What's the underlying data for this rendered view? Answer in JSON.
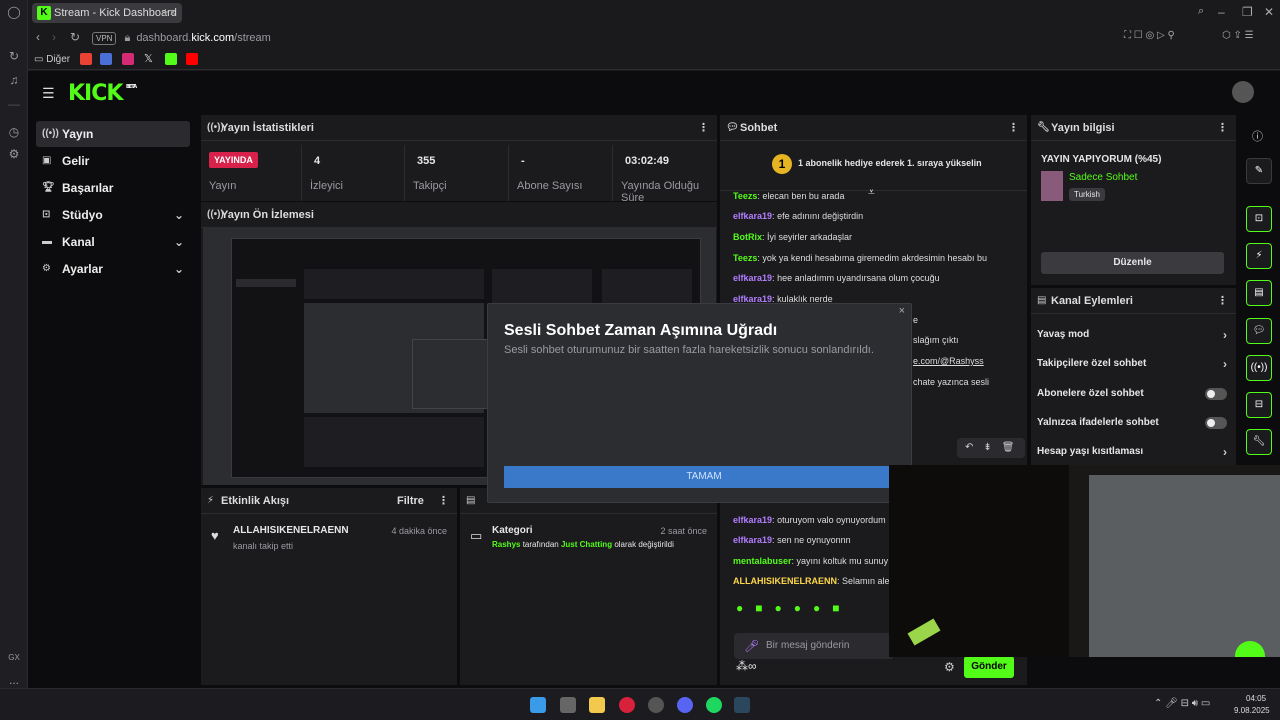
{
  "browser": {
    "tab_title": "Stream - Kick Dashboard",
    "url_domain": "dashboard.",
    "url_bold": "kick.com",
    "url_path": "/stream",
    "vpn": "VPN",
    "bookmark_folder": "Diğer",
    "gx": "GX",
    "more": "..."
  },
  "brand": {
    "logo": "KICK",
    "beta": "BETA",
    "accent": "#53fc18",
    "live_color": "#d8214b",
    "button_color": "#3a79c9"
  },
  "nav": [
    {
      "label": "Yayın",
      "icon": "live-icon",
      "active": true
    },
    {
      "label": "Gelir",
      "icon": "revenue-icon"
    },
    {
      "label": "Başarılar",
      "icon": "trophy-icon"
    },
    {
      "label": "Stüdyo",
      "icon": "studio-icon",
      "expand": true
    },
    {
      "label": "Kanal",
      "icon": "channel-icon",
      "expand": true
    },
    {
      "label": "Ayarlar",
      "icon": "settings-icon",
      "expand": true
    }
  ],
  "stats_panel": {
    "title": "Yayın İstatistikleri",
    "live_badge": "YAYINDA",
    "items": [
      {
        "value": "",
        "label": "Yayın"
      },
      {
        "value": "4",
        "label": "İzleyici"
      },
      {
        "value": "355",
        "label": "Takipçi"
      },
      {
        "value": "-",
        "label": "Abone Sayısı"
      },
      {
        "value": "03:02:49",
        "label": "Yayında Olduğu Süre"
      }
    ]
  },
  "preview_panel": {
    "title": "Yayın Ön İzlemesi"
  },
  "activity_panel": {
    "title": "Etkinlik Akışı",
    "filter": "Filtre",
    "event_user": "ALLAHISIKENELRAENN",
    "event_text": "kanalı takip etti",
    "event_time": "4 dakika önce"
  },
  "edit_panel": {
    "category_title": "Kategori",
    "category_time": "2 saat önce",
    "cat_user": "Rashys",
    "cat_mid": "tarafından",
    "cat_name": "Just Chatting",
    "cat_end": "olarak değiştirildi"
  },
  "chat_panel": {
    "title": "Sohbet",
    "banner_num": "1",
    "banner": "1 abonelik hediye ederek 1. sıraya yükselin",
    "placeholder": "Bir mesaj gönderin",
    "send": "Gönder",
    "messages": [
      {
        "user": "Teezs",
        "text": "elecan ben bu arada",
        "cls": "u-g"
      },
      {
        "user": "elfkara19",
        "text": "efe adınını değiştirdin",
        "cls": "u-p"
      },
      {
        "user": "BotRix",
        "text": "İyi seyirler arkadaşlar",
        "cls": "u-g"
      },
      {
        "user": "Teezs",
        "text": "yok ya kendi hesabıma giremedim akrdesimin hesabı bu",
        "cls": "u-g"
      },
      {
        "user": "elfkara19",
        "text": "hee anladımm uyandırsana olum çocuğu",
        "cls": "u-p"
      },
      {
        "user": "elfkara19",
        "text": "kulaklık nerde",
        "cls": "u-p"
      }
    ],
    "partial": [
      "e",
      "slağım çıktı",
      "e.com/@Rashyss",
      "chate yazınca sesli"
    ],
    "messages2": [
      {
        "user": "elfkara19",
        "text": "oturuyom valo oynuyordum",
        "cls": "u-p"
      },
      {
        "user": "elfkara19",
        "text": "sen ne oynuyonnn",
        "cls": "u-p"
      },
      {
        "user": "mentalabuser",
        "text": "yayını koltuk mu sunuy",
        "cls": "u-g"
      },
      {
        "user": "ALLAHISIKENELRAENN",
        "text": "Selamın aley",
        "cls": "u-y"
      }
    ]
  },
  "info_panel": {
    "title": "Yayın bilgisi",
    "stream_title": "YAYIN YAPIYORUM (%45)",
    "category": "Sadece Sohbet",
    "language": "Turkish",
    "edit_button": "Düzenle"
  },
  "channel_actions": {
    "title": "Kanal Eylemleri",
    "rows": [
      {
        "label": "Yavaş mod",
        "type": "chev"
      },
      {
        "label": "Takipçilere özel sohbet",
        "type": "chev"
      },
      {
        "label": "Abonelere özel sohbet",
        "type": "toggle"
      },
      {
        "label": "Yalnızca ifadelerle sohbet",
        "type": "toggle"
      },
      {
        "label": "Hesap yaşı kısıtlaması",
        "type": "chev"
      }
    ]
  },
  "modal": {
    "title": "Sesli Sohbet Zaman Aşımına Uğradı",
    "desc": "Sesli sohbet oturumunuz bir saatten fazla hareketsizlik sonucu sonlandırıldı.",
    "ok": "TAMAM",
    "close": "×"
  },
  "taskbar": {
    "time": "04:05",
    "date": "9.08.2025"
  }
}
